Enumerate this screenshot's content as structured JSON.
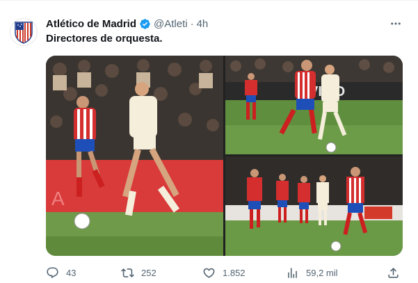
{
  "tweet": {
    "author_name": "Atlético de Madrid",
    "handle": "@Atleti",
    "separator": "·",
    "time": "4h",
    "text": "Directores de orquesta.",
    "more_icon": "more-dots-icon",
    "verified_icon": "verified-badge-icon",
    "avatar_icon": "atletico-crest-logo",
    "media": [
      {
        "name": "photo-player-dribbling",
        "alt": ""
      },
      {
        "name": "photo-player-running-with-ball",
        "alt": ""
      },
      {
        "name": "photo-team-pressing",
        "alt": ""
      }
    ]
  },
  "actions": {
    "reply": {
      "icon": "reply-icon",
      "count": "43"
    },
    "retweet": {
      "icon": "retweet-icon",
      "count": "252"
    },
    "like": {
      "icon": "heart-icon",
      "count": "1.852"
    },
    "views": {
      "icon": "views-chart-icon",
      "count": "59,2 mil"
    },
    "share": {
      "icon": "share-icon"
    }
  },
  "colors": {
    "verified": "#1d9bf0",
    "secondary_text": "#536471",
    "atleti_red": "#cb3524",
    "atleti_blue": "#1e3a8a"
  }
}
